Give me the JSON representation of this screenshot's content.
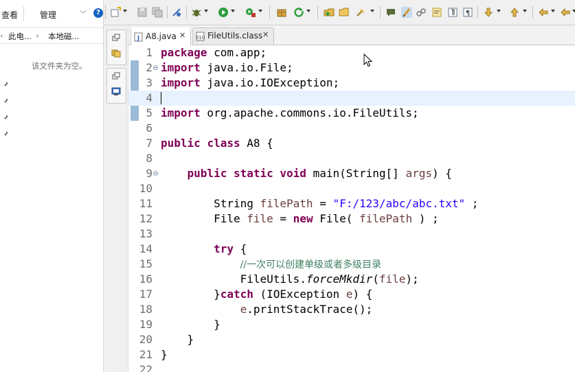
{
  "explorer": {
    "ribbon": {
      "view_tab": "查看",
      "manage_tab": "管理"
    },
    "address": {
      "separator1": "‹",
      "segment1": "此电...",
      "separator2": "›",
      "segment2": "本地磁..."
    },
    "empty_message": "该文件夹为空。",
    "pinned_count": 4
  },
  "toolbar": {
    "icons": [
      "new-icon",
      "save-icon",
      "save-all-icon",
      "toggle-breakpoint-icon",
      "debug-icon",
      "run-icon",
      "run-external-icon",
      "new-package-icon",
      "refresh-icon",
      "open-type-icon",
      "open-folder-icon",
      "search-icon",
      "annotation-icon",
      "highlight-icon",
      "link-icon",
      "show-whitespace-icon",
      "paragraph-icon",
      "next-annotation-icon",
      "previous-annotation-icon",
      "back-icon",
      "forward-icon"
    ],
    "colors": {
      "run": "#2e9e3e",
      "debug": "#5c6f2e",
      "stop": "#c0392b",
      "accent": "#3b6fbf"
    }
  },
  "editor": {
    "tabs": [
      {
        "label": "A8.java",
        "active": true,
        "close": "✕"
      },
      {
        "label": "FileUtils.class",
        "active": false,
        "close": "✕"
      }
    ],
    "current_line": 4,
    "lines": [
      {
        "n": "1",
        "tokens": [
          {
            "t": "package",
            "c": "kw"
          },
          {
            "t": " com.app;",
            "c": ""
          }
        ]
      },
      {
        "n": "2",
        "fold": true,
        "tokens": [
          {
            "t": "import",
            "c": "kw"
          },
          {
            "t": " java.io.File;",
            "c": ""
          }
        ]
      },
      {
        "n": "3",
        "tokens": [
          {
            "t": "import",
            "c": "kw"
          },
          {
            "t": " java.io.IOException;",
            "c": ""
          }
        ]
      },
      {
        "n": "4",
        "tokens": []
      },
      {
        "n": "5",
        "tokens": [
          {
            "t": "import",
            "c": "kw"
          },
          {
            "t": " org.apache.commons.io.FileUtils;",
            "c": ""
          }
        ]
      },
      {
        "n": "6",
        "tokens": []
      },
      {
        "n": "7",
        "tokens": [
          {
            "t": "public",
            "c": "kw"
          },
          {
            "t": " ",
            "c": ""
          },
          {
            "t": "class",
            "c": "kw"
          },
          {
            "t": " A8 {",
            "c": ""
          }
        ]
      },
      {
        "n": "8",
        "tokens": []
      },
      {
        "n": "9",
        "fold": true,
        "tokens": [
          {
            "t": "    ",
            "c": ""
          },
          {
            "t": "public",
            "c": "kw"
          },
          {
            "t": " ",
            "c": ""
          },
          {
            "t": "static",
            "c": "kw"
          },
          {
            "t": " ",
            "c": ""
          },
          {
            "t": "void",
            "c": "kw"
          },
          {
            "t": " main(String[] ",
            "c": ""
          },
          {
            "t": "args",
            "c": "var"
          },
          {
            "t": ") {",
            "c": ""
          }
        ]
      },
      {
        "n": "10",
        "tokens": []
      },
      {
        "n": "11",
        "tokens": [
          {
            "t": "        String ",
            "c": ""
          },
          {
            "t": "filePath",
            "c": "var"
          },
          {
            "t": " = ",
            "c": ""
          },
          {
            "t": "\"F:/123/abc/abc.txt\"",
            "c": "str"
          },
          {
            "t": " ;",
            "c": ""
          }
        ]
      },
      {
        "n": "12",
        "tokens": [
          {
            "t": "        File ",
            "c": ""
          },
          {
            "t": "file",
            "c": "var"
          },
          {
            "t": " = ",
            "c": ""
          },
          {
            "t": "new",
            "c": "kw"
          },
          {
            "t": " File( ",
            "c": ""
          },
          {
            "t": "filePath",
            "c": "var"
          },
          {
            "t": " ) ;",
            "c": ""
          }
        ]
      },
      {
        "n": "13",
        "tokens": []
      },
      {
        "n": "14",
        "tokens": [
          {
            "t": "        ",
            "c": ""
          },
          {
            "t": "try",
            "c": "kw"
          },
          {
            "t": " {",
            "c": ""
          }
        ]
      },
      {
        "n": "15",
        "tokens": [
          {
            "t": "            ",
            "c": ""
          },
          {
            "t": "//一次可以创建单级或者多级目录",
            "c": "cmt"
          }
        ]
      },
      {
        "n": "16",
        "tokens": [
          {
            "t": "            FileUtils.",
            "c": ""
          },
          {
            "t": "forceMkdir",
            "c": "it"
          },
          {
            "t": "(",
            "c": ""
          },
          {
            "t": "file",
            "c": "var"
          },
          {
            "t": ");",
            "c": ""
          }
        ]
      },
      {
        "n": "17",
        "tokens": [
          {
            "t": "        }",
            "c": ""
          },
          {
            "t": "catch",
            "c": "kw"
          },
          {
            "t": " (IOException ",
            "c": ""
          },
          {
            "t": "e",
            "c": "var"
          },
          {
            "t": ") {",
            "c": ""
          }
        ]
      },
      {
        "n": "18",
        "tokens": [
          {
            "t": "            ",
            "c": ""
          },
          {
            "t": "e",
            "c": "var"
          },
          {
            "t": ".printStackTrace();",
            "c": ""
          }
        ]
      },
      {
        "n": "19",
        "tokens": [
          {
            "t": "        }",
            "c": ""
          }
        ]
      },
      {
        "n": "20",
        "tokens": [
          {
            "t": "    }",
            "c": ""
          }
        ]
      },
      {
        "n": "21",
        "tokens": [
          {
            "t": "}",
            "c": ""
          }
        ]
      },
      {
        "n": "22",
        "tokens": []
      }
    ]
  }
}
